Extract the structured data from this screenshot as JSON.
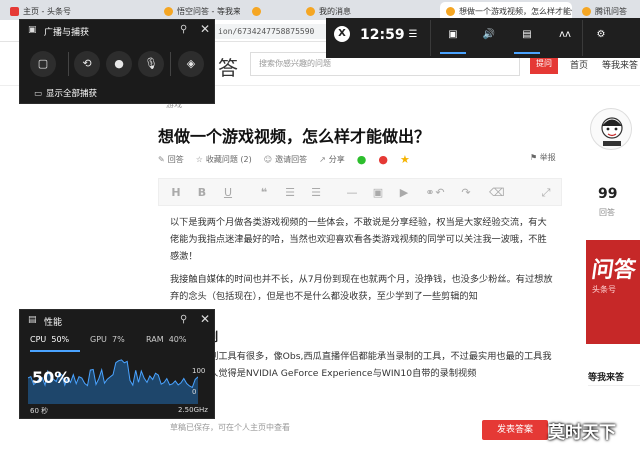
{
  "browser": {
    "tabs": [
      {
        "title": "主页 - 头条号",
        "active": false
      },
      {
        "title": "悟空问答 - 等我来答",
        "active": false
      },
      {
        "title": "",
        "active": false
      },
      {
        "title": "我的消息",
        "active": false
      },
      {
        "title": "想做一个游戏视频，怎么样才能做",
        "active": true
      },
      {
        "title": "腾讯问答",
        "active": false
      }
    ],
    "new_tab": "+",
    "url": "ion/6734247758875590"
  },
  "site": {
    "logo_fragment": "答",
    "search_placeholder": "搜索你感兴趣的问题",
    "ask_button": "提问",
    "nav_home": "首页",
    "nav_mine": "等我来答"
  },
  "article": {
    "breadcrumb": "游戏",
    "title": "想做一个游戏视频，怎么样才能做出？",
    "actions": [
      {
        "icon": "pencil-icon",
        "label": "回答"
      },
      {
        "icon": "star-icon",
        "label": "收藏问题 (2)"
      },
      {
        "icon": "invite-icon",
        "label": "邀请回答"
      },
      {
        "icon": "share-icon",
        "label": "分享"
      }
    ],
    "report": "举报",
    "paragraph1": "以下是我两个月做各类游戏视频的一些体会，不敢说是分享经验，权当是大家经验交流，有大佬能为我指点迷津最好的哈，当然也欢迎喜欢看各类游戏视频的同学可以关注我一波哦，不胜感激！",
    "paragraph2": "我接触自媒体的时间也并不长，从7月份到现在也就两个月，没挣钱，也没多少粉丝。有过想放弃的念头（包括现在），但是也不是什么都没收获，至少学到了一些剪辑的知",
    "heading_fragment": "制",
    "paragraph3": "录制工具有很多，像Obs,西瓜直播伴侣都能承当录制的工具，不过最实用也最的工具我个人觉得是NVIDIA GeForce Experience与WIN10自带的录制视频",
    "footer_note": "草稿已保存，可在个人主页中查看",
    "publish_button": "发表答案"
  },
  "sidebar": {
    "answer_count": "99",
    "answer_label": "回答",
    "ad_text": "问答",
    "ad_sub": "头条号",
    "section_title": "等我来答"
  },
  "gamebar": {
    "time": "12:59",
    "icons": [
      "xbox-icon",
      "menu-icon",
      "capture-widget-icon",
      "audio-icon",
      "performance-icon",
      "social-icon",
      "settings-icon"
    ]
  },
  "capture_panel": {
    "title": "广播与捕获",
    "buttons": [
      "screenshot-icon",
      "record-last-icon",
      "record-icon",
      "mic-off-icon",
      "broadcast-icon"
    ],
    "show_all": "显示全部捕获"
  },
  "performance_panel": {
    "title": "性能",
    "tabs": [
      {
        "label": "CPU",
        "value": "50%"
      },
      {
        "label": "GPU",
        "value": "7%"
      },
      {
        "label": "RAM",
        "value": "40%"
      }
    ],
    "current": "50%",
    "axis_top": "100",
    "axis_bottom": "0",
    "time_label": "60 秒",
    "freq_label": "2.50GHz",
    "accent": "#4aa3ff"
  },
  "watermark": "莫时天下",
  "colors": {
    "accent_red": "#e53935",
    "gamebar_bg": "#1f1f1f",
    "gamebar_accent": "#4aa3ff"
  }
}
